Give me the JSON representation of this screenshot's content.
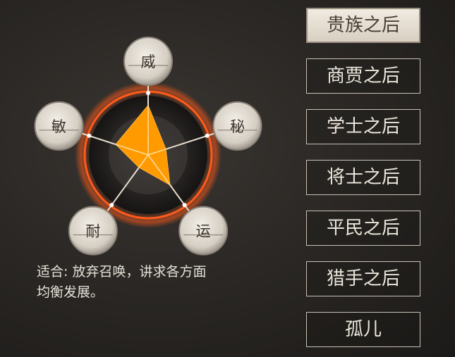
{
  "attributes": [
    {
      "key": "wei",
      "label": "威",
      "value": 0.8
    },
    {
      "key": "mi",
      "label": "秘",
      "value": 0.3
    },
    {
      "key": "yun",
      "label": "运",
      "value": 0.6
    },
    {
      "key": "nai",
      "label": "耐",
      "value": 0.25
    },
    {
      "key": "min",
      "label": "敏",
      "value": 0.55
    }
  ],
  "description": {
    "line1": "适合: 放弃召唤，讲求各方面",
    "line2": "均衡发展。"
  },
  "backgrounds": [
    {
      "label": "贵族之后",
      "selected": true
    },
    {
      "label": "商贾之后",
      "selected": false
    },
    {
      "label": "学士之后",
      "selected": false
    },
    {
      "label": "将士之后",
      "selected": false
    },
    {
      "label": "平民之后",
      "selected": false
    },
    {
      "label": "猎手之后",
      "selected": false
    },
    {
      "label": "孤儿",
      "selected": false
    }
  ],
  "colors": {
    "fill": "#ff9a00",
    "ring": "#ff5a1a",
    "button_text": "#ece6dc"
  }
}
